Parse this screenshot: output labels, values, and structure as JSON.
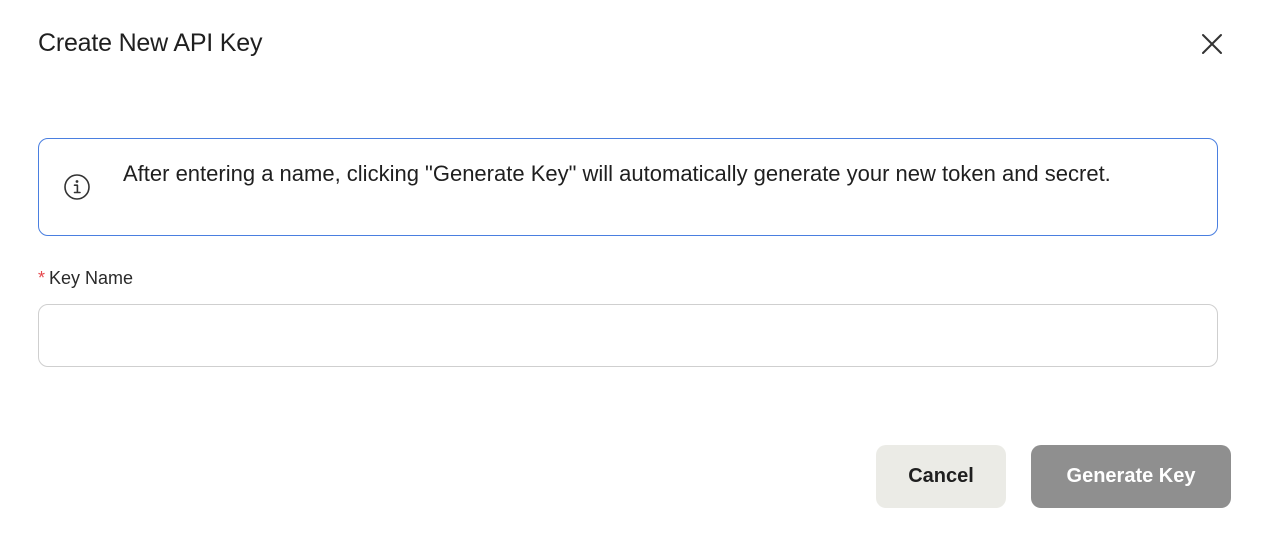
{
  "dialog": {
    "title": "Create New API Key",
    "close_icon": "close-icon"
  },
  "info": {
    "icon": "info-icon",
    "text": "After entering a name, clicking \"Generate Key\" will automatically generate your new token and secret.",
    "border_color": "#4a7fe0"
  },
  "form": {
    "key_name": {
      "required_marker": "*",
      "label": "Key Name",
      "value": "",
      "placeholder": ""
    }
  },
  "actions": {
    "cancel_label": "Cancel",
    "generate_label": "Generate Key",
    "generate_disabled": true
  },
  "colors": {
    "required": "#e5484d",
    "cancel_bg": "#ebebe6",
    "generate_bg": "#8f8f8f"
  }
}
